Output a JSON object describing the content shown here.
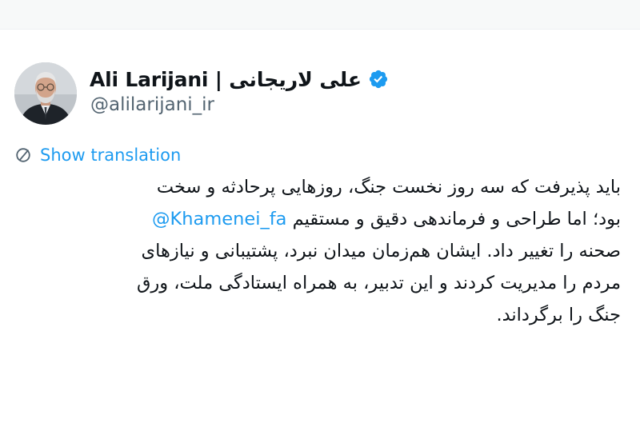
{
  "colors": {
    "text_primary": "#0f1419",
    "text_secondary": "#536471",
    "accent_blue": "#1d9bf0",
    "verified_badge": "#1d9bf0"
  },
  "author": {
    "display_name": "Ali Larijani | علی لاریجانی",
    "handle": "@alilarijani_ir",
    "verified": true,
    "verified_icon": "verified-badge-icon",
    "avatar_icon": "profile-photo"
  },
  "translation": {
    "icon": "globe-icon",
    "label": "Show translation"
  },
  "tweet": {
    "line1": "باید پذیرفت که سه روز نخست جنگ، روزهایی پرحادثه و سخت",
    "line2_text": "بود؛ اما طراحی و فرماندهی دقیق و مستقیم",
    "line2_mention": "@Khamenei_fa",
    "line3": "صحنه را تغییر داد. ایشان هم‌زمان میدان نبرد، پشتیبانی و نیازهای",
    "line4": "مردم را مدیریت کردند و این تدبیر، به همراه ایستادگی ملت، ورق",
    "line5": "جنگ را برگرداند."
  }
}
